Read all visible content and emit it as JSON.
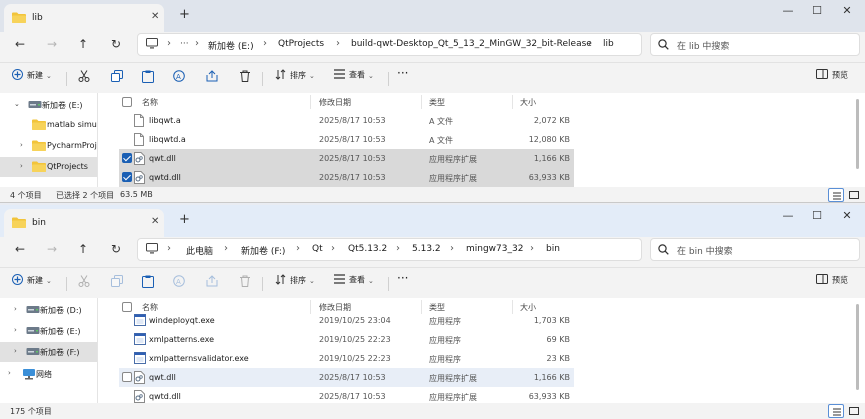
{
  "colors": {
    "accent": "#1a5fb4",
    "folder": "#f2c43b",
    "selected_row": "#d9d9d9"
  },
  "window1": {
    "tab_title": "lib",
    "address": [
      "新加卷 (E:)",
      "QtProjects",
      "build-qwt-Desktop_Qt_5_13_2_MinGW_32_bit-Release",
      "lib"
    ],
    "search_placeholder": "在 lib 中搜索",
    "commands": {
      "new": "新建",
      "sort": "排序",
      "view": "查看",
      "preview": "预览"
    },
    "sidebar": [
      {
        "label": "新加卷 (E:)",
        "icon": "drive-icon",
        "expanded": true
      },
      {
        "label": "matlab simu",
        "icon": "folder-icon"
      },
      {
        "label": "PycharmProj",
        "icon": "folder-icon"
      },
      {
        "label": "QtProjects",
        "icon": "folder-icon",
        "selected": true
      }
    ],
    "columns": [
      "名称",
      "修改日期",
      "类型",
      "大小"
    ],
    "files": [
      {
        "name": "libqwt.a",
        "date": "2025/8/17 10:53",
        "type": "A 文件",
        "size": "2,072 KB",
        "icon": "file-icon",
        "checked": false,
        "selected": false
      },
      {
        "name": "libqwtd.a",
        "date": "2025/8/17 10:53",
        "type": "A 文件",
        "size": "12,080 KB",
        "icon": "file-icon",
        "checked": false,
        "selected": false
      },
      {
        "name": "qwt.dll",
        "date": "2025/8/17 10:53",
        "type": "应用程序扩展",
        "size": "1,166 KB",
        "icon": "dll-icon",
        "checked": true,
        "selected": true
      },
      {
        "name": "qwtd.dll",
        "date": "2025/8/17 10:53",
        "type": "应用程序扩展",
        "size": "63,933 KB",
        "icon": "dll-icon",
        "checked": true,
        "selected": true
      }
    ],
    "status": {
      "count": "4 个项目",
      "selection": "已选择 2 个项目",
      "size": "63.5 MB"
    }
  },
  "window2": {
    "tab_title": "bin",
    "address": [
      "此电脑",
      "新加卷 (F:)",
      "Qt",
      "Qt5.13.2",
      "5.13.2",
      "mingw73_32",
      "bin"
    ],
    "search_placeholder": "在 bin 中搜索",
    "commands": {
      "new": "新建",
      "sort": "排序",
      "view": "查看",
      "preview": "预览"
    },
    "sidebar": [
      {
        "label": "新加卷 (D:)",
        "icon": "drive-icon"
      },
      {
        "label": "新加卷 (E:)",
        "icon": "drive-icon"
      },
      {
        "label": "新加卷 (F:)",
        "icon": "drive-icon",
        "selected": true
      },
      {
        "label": "网络",
        "icon": "network-icon"
      }
    ],
    "columns": [
      "名称",
      "修改日期",
      "类型",
      "大小"
    ],
    "files": [
      {
        "name": "windeployqt.exe",
        "date": "2019/10/25 23:04",
        "type": "应用程序",
        "size": "1,703 KB",
        "icon": "exe-icon",
        "checked": false,
        "selected": false
      },
      {
        "name": "xmlpatterns.exe",
        "date": "2019/10/25 22:23",
        "type": "应用程序",
        "size": "69 KB",
        "icon": "exe-icon",
        "checked": false,
        "selected": false
      },
      {
        "name": "xmlpatternsvalidator.exe",
        "date": "2019/10/25 22:23",
        "type": "应用程序",
        "size": "23 KB",
        "icon": "exe-icon",
        "checked": false,
        "selected": false
      },
      {
        "name": "qwt.dll",
        "date": "2025/8/17 10:53",
        "type": "应用程序扩展",
        "size": "1,166 KB",
        "icon": "dll-icon",
        "checked": false,
        "selected": false,
        "hover": true
      },
      {
        "name": "qwtd.dll",
        "date": "2025/8/17 10:53",
        "type": "应用程序扩展",
        "size": "63,933 KB",
        "icon": "dll-icon",
        "checked": false,
        "selected": false
      }
    ],
    "status": {
      "count": "175 个项目"
    }
  }
}
